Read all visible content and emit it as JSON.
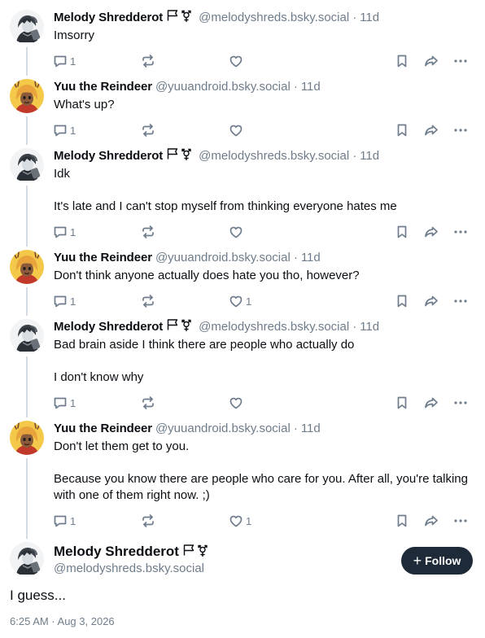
{
  "posts": [
    {
      "author": "Melody Shredderot",
      "handle": "@melodyshreds.bsky.social",
      "time": "11d",
      "paragraphs": [
        "Imsorry"
      ],
      "reply_count": "1",
      "like_count": "",
      "avatar": "melody"
    },
    {
      "author": "Yuu the Reindeer",
      "handle": "@yuuandroid.bsky.social",
      "time": "11d",
      "paragraphs": [
        "What's up?"
      ],
      "reply_count": "1",
      "like_count": "",
      "avatar": "yuu"
    },
    {
      "author": "Melody Shredderot",
      "handle": "@melodyshreds.bsky.social",
      "time": "11d",
      "paragraphs": [
        "Idk",
        "It's late and I can't stop myself from thinking everyone hates me"
      ],
      "reply_count": "1",
      "like_count": "",
      "avatar": "melody"
    },
    {
      "author": "Yuu the Reindeer",
      "handle": "@yuuandroid.bsky.social",
      "time": "11d",
      "paragraphs": [
        "Don't think anyone actually does hate you tho, however?"
      ],
      "reply_count": "1",
      "like_count": "1",
      "avatar": "yuu"
    },
    {
      "author": "Melody Shredderot",
      "handle": "@melodyshreds.bsky.social",
      "time": "11d",
      "paragraphs": [
        "Bad brain aside I think there are people who actually do",
        "I don't know why"
      ],
      "reply_count": "1",
      "like_count": "",
      "avatar": "melody"
    },
    {
      "author": "Yuu the Reindeer",
      "handle": "@yuuandroid.bsky.social",
      "time": "11d",
      "paragraphs": [
        "Don't let them get to you.",
        "Because you know there are people who care for you. After all, you're talking with one of them right now. ;)"
      ],
      "reply_count": "1",
      "like_count": "1",
      "avatar": "yuu"
    }
  ],
  "anchor": {
    "author": "Melody Shredderot",
    "handle": "@melodyshreds.bsky.social",
    "follow_label": "Follow",
    "text": "I guess...",
    "timestamp": "6:25 AM · Aug 3, 2026",
    "avatar": "melody"
  },
  "separator": "·",
  "icons": {
    "flags": [
      "white-flag-icon",
      "transgender-symbol-icon"
    ],
    "actions": [
      "reply-icon",
      "repost-icon",
      "like-icon",
      "bookmark-icon",
      "share-icon",
      "more-options-icon"
    ]
  },
  "colors": {
    "text": "#0b0f14",
    "muted": "#6f7c8b",
    "thread_line": "#d4dbe2",
    "follow_bg": "#1e2a37"
  }
}
